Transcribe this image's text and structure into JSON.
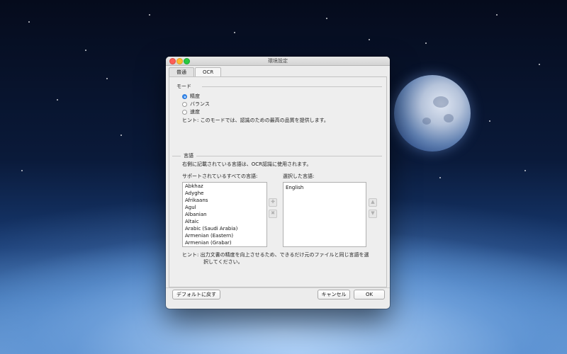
{
  "window": {
    "title": "環境設定",
    "tabs": [
      {
        "label": "普通",
        "active": false
      },
      {
        "label": "OCR",
        "active": true
      }
    ]
  },
  "mode": {
    "heading": "モード",
    "options": [
      {
        "label": "精度",
        "selected": true
      },
      {
        "label": "バランス",
        "selected": false
      },
      {
        "label": "速度",
        "selected": false
      }
    ],
    "hint": "ヒント:  このモードでは、認識のための最高の品質を提供します。"
  },
  "language": {
    "heading": "言語",
    "description": "右側に記載されている言語は、OCR認識に使用されます。",
    "supported_label": "サポートされているすべての言語:",
    "selected_label": "選択した言語:",
    "supported": [
      "Abkhaz",
      "Adyghe",
      "Afrikaans",
      "Agul",
      "Albanian",
      "Altaic",
      "Arabic (Saudi Arabia)",
      "Armenian (Eastern)",
      "Armenian (Grabar)"
    ],
    "selected": [
      "English"
    ],
    "hint_line1": "ヒント:  出力文書の精度を向上させるため、できるだけ元のファイルと同じ言語を選",
    "hint_line2": "択してください。"
  },
  "footer": {
    "default_button": "デフォルトに戻す",
    "cancel_button": "キャンセル",
    "ok_button": "OK"
  },
  "icons": {
    "add": "plus-icon",
    "remove": "remove-icon",
    "up": "arrow-up-icon",
    "down": "arrow-down-icon"
  },
  "colors": {
    "radio_selected": "#3b8ef0",
    "close": "#fc5f57",
    "minimize": "#fdbc2e",
    "zoom": "#29c940"
  }
}
